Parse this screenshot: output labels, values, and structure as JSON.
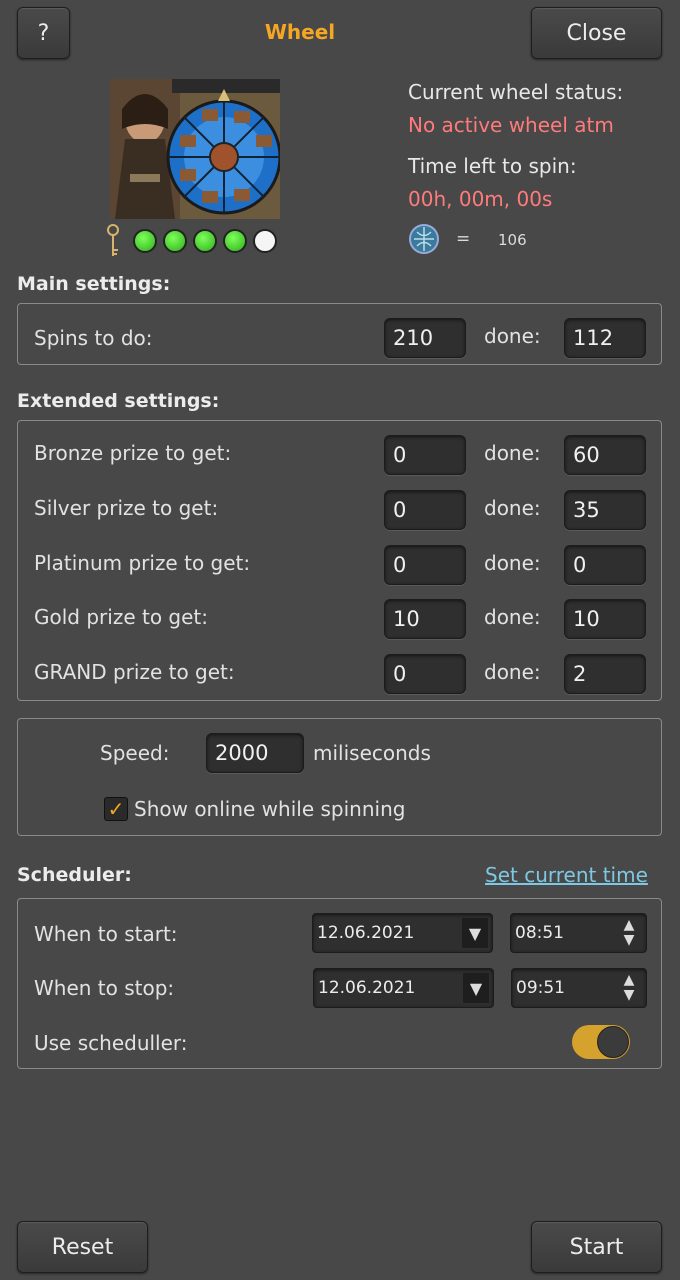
{
  "header": {
    "help_label": "?",
    "title": "Wheel",
    "close_label": "Close"
  },
  "status": {
    "current_label": "Current wheel status:",
    "current_value": "No active wheel atm",
    "time_label": "Time left to spin:",
    "time_value": "00h, 00m, 00s",
    "equals": "=",
    "token_count": "106"
  },
  "keys": {
    "filled": 4,
    "total": 5
  },
  "main": {
    "title": "Main settings:",
    "spins_label": "Spins to do:",
    "spins_value": "210",
    "done_label": "done:",
    "spins_done": "112"
  },
  "extended": {
    "title": "Extended settings:",
    "done_label": "done:",
    "rows": [
      {
        "label": "Bronze prize to get:",
        "value": "0",
        "done": "60"
      },
      {
        "label": "Silver prize to get:",
        "value": "0",
        "done": "35"
      },
      {
        "label": "Platinum prize to get:",
        "value": "0",
        "done": "0"
      },
      {
        "label": "Gold prize to get:",
        "value": "10",
        "done": "10"
      },
      {
        "label": "GRAND prize to get:",
        "value": "0",
        "done": "2"
      }
    ]
  },
  "speed": {
    "label": "Speed:",
    "value": "2000",
    "unit": "miliseconds",
    "show_online_label": "Show online while spinning",
    "show_online_checked": true
  },
  "scheduler": {
    "title": "Scheduler:",
    "set_time_link": "Set current time",
    "start_label": "When to start:",
    "start_date": "12.06.2021",
    "start_time": "08:51",
    "stop_label": "When to stop:",
    "stop_date": "12.06.2021",
    "stop_time": "09:51",
    "use_label": "Use scheduller:",
    "use_enabled": true
  },
  "footer": {
    "reset_label": "Reset",
    "start_label": "Start"
  },
  "colors": {
    "accent": "#f5a623",
    "status_red": "#ff7b7b",
    "link": "#7ec8e3",
    "key_dot_on": "#3fcf25",
    "key_dot_off": "#f5f5f5"
  }
}
